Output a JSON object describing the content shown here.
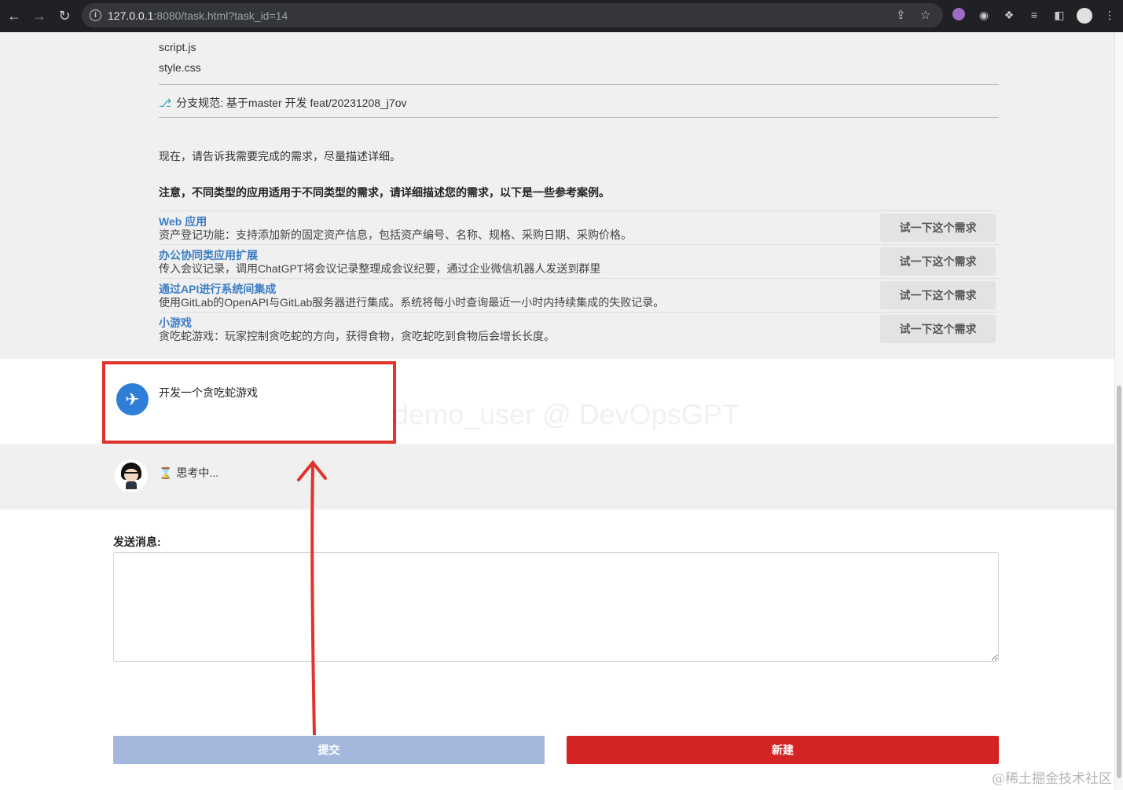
{
  "browser": {
    "url_host": "127.0.0.1",
    "url_rest": ":8080/task.html?task_id=14"
  },
  "files": [
    "script.js",
    "style.css"
  ],
  "branch_text": "分支规范: 基于master 开发 feat/20231208_j7ov",
  "intro": "现在，请告诉我需要完成的需求，尽量描述详细。",
  "notice": "注意，不同类型的应用适用于不同类型的需求，请详细描述您的需求，以下是一些参考案例。",
  "cases": [
    {
      "title": "Web 应用",
      "desc": "资产登记功能：支持添加新的固定资产信息，包括资产编号、名称、规格、采购日期、采购价格。",
      "button": "试一下这个需求"
    },
    {
      "title": "办公协同类应用扩展",
      "desc": "传入会议记录，调用ChatGPT将会议记录整理成会议纪要，通过企业微信机器人发送到群里",
      "button": "试一下这个需求"
    },
    {
      "title": "通过API进行系统间集成",
      "desc": "使用GitLab的OpenAPI与GitLab服务器进行集成。系统将每小时查询最近一小时内持续集成的失败记录。",
      "button": "试一下这个需求"
    },
    {
      "title": "小游戏",
      "desc": "贪吃蛇游戏：玩家控制贪吃蛇的方向，获得食物，贪吃蛇吃到食物后会增长长度。",
      "button": "试一下这个需求"
    }
  ],
  "user_message": "开发一个贪吃蛇游戏",
  "watermark": "demo_user @ DevOpsGPT",
  "bot_status": "思考中...",
  "send_label": "发送消息:",
  "send_value": "",
  "submit_label": "提交",
  "new_label": "新建",
  "footer_watermark": "@稀土掘金技术社区",
  "colors": {
    "accent": "#3d7ec4",
    "danger": "#d42325",
    "submit_disabled": "#a4b7dd",
    "highlight": "#e0332b"
  }
}
